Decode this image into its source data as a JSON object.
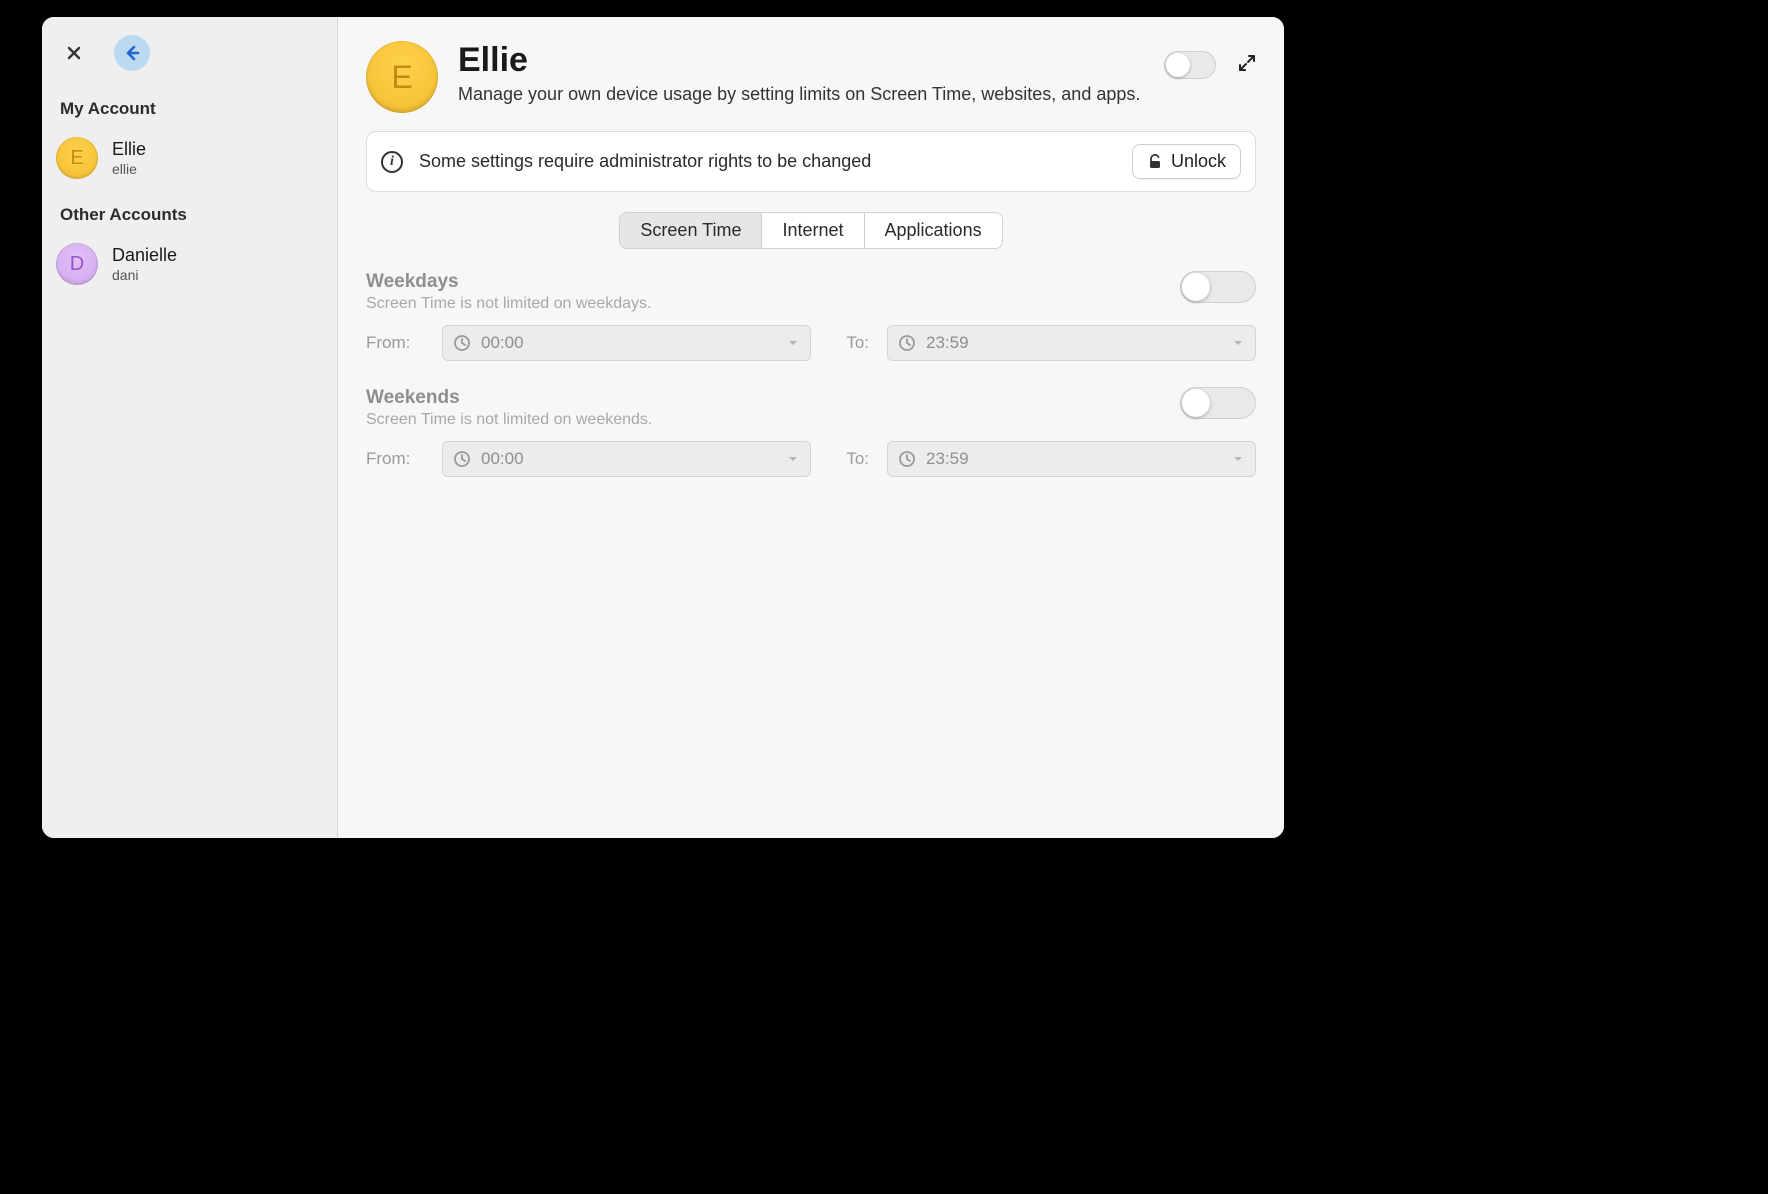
{
  "sidebar": {
    "sections": {
      "my_account_header": "My Account",
      "other_accounts_header": "Other Accounts"
    },
    "accounts": [
      {
        "initial": "E",
        "avatar_color": "yellow",
        "name": "Ellie",
        "sub": "ellie"
      },
      {
        "initial": "D",
        "avatar_color": "purple",
        "name": "Danielle",
        "sub": "dani"
      }
    ]
  },
  "header": {
    "avatar_initial": "E",
    "title": "Ellie",
    "subtitle": "Manage your own device usage by setting limits on Screen Time, websites, and apps."
  },
  "banner": {
    "text": "Some settings require administrator rights to be changed",
    "unlock_label": "Unlock"
  },
  "tabs": {
    "screen_time": "Screen Time",
    "internet": "Internet",
    "applications": "Applications"
  },
  "weekdays": {
    "title": "Weekdays",
    "sub": "Screen Time is not limited on weekdays.",
    "from_label": "From:",
    "to_label": "To:",
    "from_value": "00:00",
    "to_value": "23:59"
  },
  "weekends": {
    "title": "Weekends",
    "sub": "Screen Time is not limited on weekends.",
    "from_label": "From:",
    "to_label": "To:",
    "from_value": "00:00",
    "to_value": "23:59"
  }
}
